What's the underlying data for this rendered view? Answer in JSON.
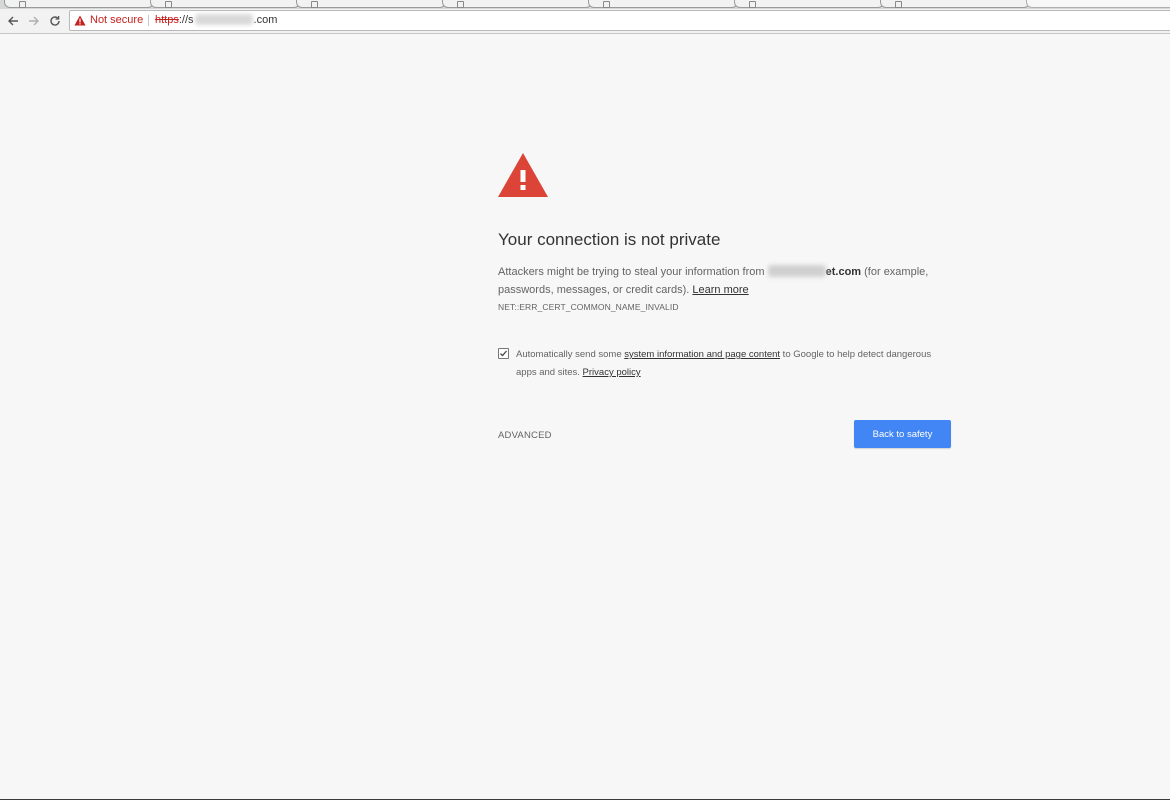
{
  "browser": {
    "not_secure_label": "Not secure",
    "url": {
      "scheme": "https",
      "separator": "://",
      "host_start": "s",
      "host_end": ".com"
    }
  },
  "interstitial": {
    "heading": "Your connection is not private",
    "explanation": {
      "prefix": "Attackers might be trying to steal your information from ",
      "domain_visible": "et.com",
      "suffix": " (for example, passwords, messages, or credit cards). ",
      "learn_more": "Learn more"
    },
    "error_code": "NET::ERR_CERT_COMMON_NAME_INVALID",
    "report": {
      "checked": true,
      "prefix": "Automatically send some ",
      "link": "system information and page content",
      "middle": " to Google to help detect dangerous apps and sites. ",
      "privacy_policy": "Privacy policy"
    },
    "advanced_label": "ADVANCED",
    "primary_button": "Back to safety"
  },
  "colors": {
    "warning_red": "#db4437",
    "primary_blue": "#4285f4",
    "not_secure_red": "#c5221f",
    "background": "#f7f7f7"
  },
  "icons": [
    "back-arrow-icon",
    "forward-arrow-icon",
    "reload-icon",
    "warning-icon",
    "checkmark-icon"
  ]
}
